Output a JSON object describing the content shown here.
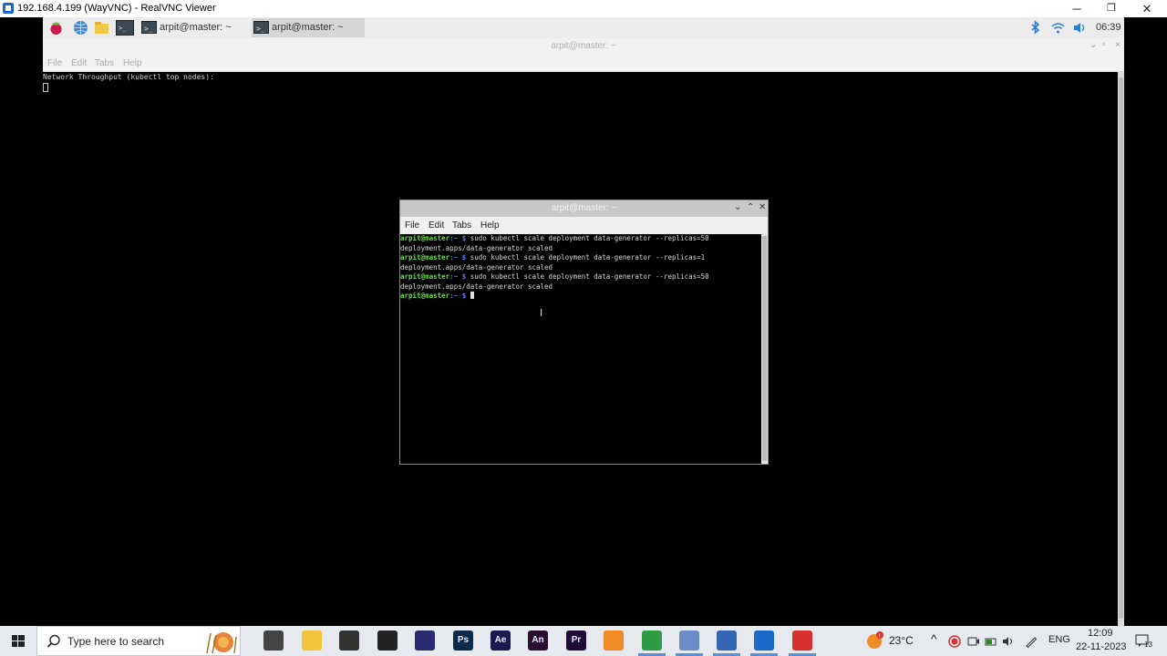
{
  "vnc": {
    "title": "192.168.4.199 (WayVNC) - RealVNC Viewer",
    "minimize": "─",
    "restore": "❐",
    "close": "✕"
  },
  "rpi_panel": {
    "tasks": [
      {
        "label": "arpit@master: ~"
      },
      {
        "label": "arpit@master: ~"
      }
    ],
    "clock": "06:39"
  },
  "bg_terminal": {
    "title": "arpit@master: ~",
    "menu": [
      "File",
      "Edit",
      "Tabs",
      "Help"
    ],
    "line1": "Network Throughput (kubectl top nodes):"
  },
  "fg_terminal": {
    "title": "arpit@master: ~",
    "menu": [
      "File",
      "Edit",
      "Tabs",
      "Help"
    ],
    "lines": [
      {
        "type": "cmd",
        "prompt": "arpit@master",
        "path": ":~ $",
        "text": " sudo kubectl scale deployment data-generator --replicas=50"
      },
      {
        "type": "out",
        "text": "deployment.apps/data-generator scaled"
      },
      {
        "type": "cmd",
        "prompt": "arpit@master",
        "path": ":~ $",
        "text": " sudo kubectl scale deployment data-generator --replicas=1"
      },
      {
        "type": "out",
        "text": "deployment.apps/data-generator scaled"
      },
      {
        "type": "cmd",
        "prompt": "arpit@master",
        "path": ":~ $",
        "text": " sudo kubectl scale deployment data-generator --replicas=50"
      },
      {
        "type": "out",
        "text": "deployment.apps/data-generator scaled"
      },
      {
        "type": "cmd",
        "prompt": "arpit@master",
        "path": ":~ $",
        "text": " "
      }
    ]
  },
  "taskbar": {
    "search_placeholder": "Type here to search",
    "apps": [
      {
        "name": "task-view",
        "label": "",
        "color": "#444444"
      },
      {
        "name": "file-explorer",
        "label": "",
        "color": "#f2c23a"
      },
      {
        "name": "store",
        "label": "",
        "color": "#333333"
      },
      {
        "name": "xbox",
        "label": "",
        "color": "#222222"
      },
      {
        "name": "headset",
        "label": "",
        "color": "#2a2a70"
      },
      {
        "name": "photoshop",
        "label": "Ps",
        "color": "#0c2a4a"
      },
      {
        "name": "after-effects",
        "label": "Ae",
        "color": "#1a1a50"
      },
      {
        "name": "animate",
        "label": "An",
        "color": "#2a1030"
      },
      {
        "name": "premiere",
        "label": "Pr",
        "color": "#1f0a3a"
      },
      {
        "name": "sublime",
        "label": "",
        "color": "#f08a24"
      },
      {
        "name": "chrome",
        "label": "",
        "color": "#2e9b45"
      },
      {
        "name": "network-tool",
        "label": "",
        "color": "#6a8cc8"
      },
      {
        "name": "remote-desktop",
        "label": "",
        "color": "#3466b3"
      },
      {
        "name": "realvnc",
        "label": "",
        "color": "#1b6ac9"
      },
      {
        "name": "recorder",
        "label": "",
        "color": "#d93030"
      }
    ],
    "weather": "23°C",
    "language": "ENG",
    "time": "12:09",
    "date": "22-11-2023",
    "notifications": "13"
  }
}
